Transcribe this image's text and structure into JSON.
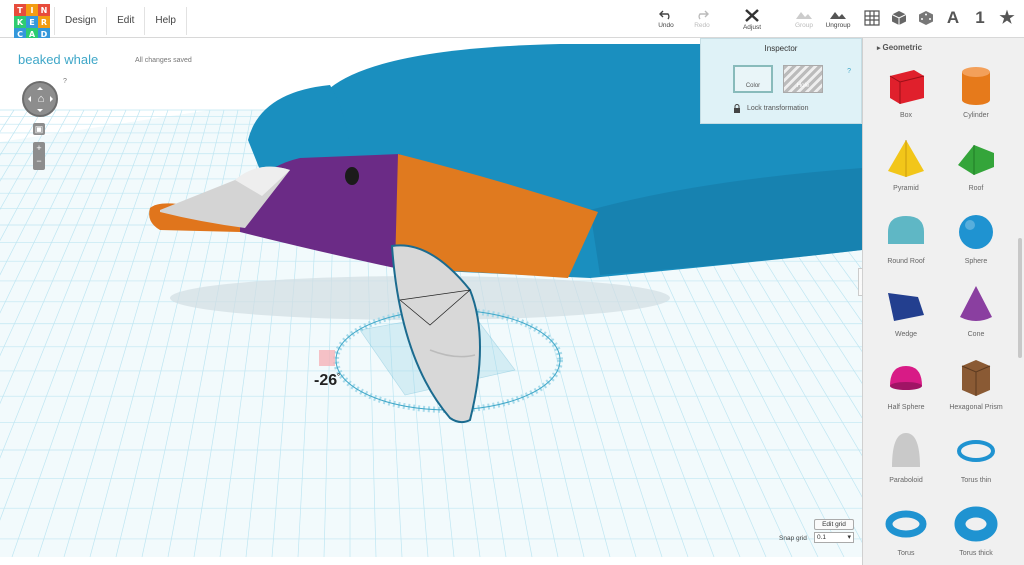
{
  "logo": {
    "letters": [
      "T",
      "I",
      "N",
      "K",
      "E",
      "R",
      "C",
      "A",
      "D"
    ],
    "colors": [
      "#e74c3c",
      "#f39c12",
      "#e74c3c",
      "#2ecc71",
      "#3498db",
      "#f39c12",
      "#3498db",
      "#2ecc71",
      "#3498db"
    ]
  },
  "menu": {
    "design": "Design",
    "edit": "Edit",
    "help": "Help"
  },
  "toolbar": {
    "undo": "Undo",
    "redo": "Redo",
    "adjust": "Adjust",
    "group": "Group",
    "ungroup": "Ungroup"
  },
  "view_tools": {
    "text_tool": "A",
    "number_tool": "1",
    "star_tool": "★"
  },
  "document": {
    "title": "beaked whale",
    "status": "All changes saved",
    "help_mark": "?"
  },
  "rotation": {
    "angle": "-26",
    "unit": "°"
  },
  "inspector": {
    "title": "Inspector",
    "color_label": "Color",
    "hole_label": "Hole",
    "lock_label": "Lock transformation",
    "help_mark": "?"
  },
  "library": {
    "section": "Geometric",
    "shapes": [
      {
        "label": "Box",
        "icon": "box-icon",
        "color": "#e0202c"
      },
      {
        "label": "Cylinder",
        "icon": "cylinder-icon",
        "color": "#e67a1b"
      },
      {
        "label": "Pyramid",
        "icon": "pyramid-icon",
        "color": "#f2c619"
      },
      {
        "label": "Roof",
        "icon": "roof-icon",
        "color": "#34a53a"
      },
      {
        "label": "Round Roof",
        "icon": "round-roof-icon",
        "color": "#5fb7c5"
      },
      {
        "label": "Sphere",
        "icon": "sphere-icon",
        "color": "#1f93d1"
      },
      {
        "label": "Wedge",
        "icon": "wedge-icon",
        "color": "#233f8f"
      },
      {
        "label": "Cone",
        "icon": "cone-icon",
        "color": "#8a3fa0"
      },
      {
        "label": "Half Sphere",
        "icon": "half-sphere-icon",
        "color": "#d81b86"
      },
      {
        "label": "Hexagonal Prism",
        "icon": "hexagonal-prism-icon",
        "color": "#8a5a34"
      },
      {
        "label": "Paraboloid",
        "icon": "paraboloid-icon",
        "color": "#c9c9c9"
      },
      {
        "label": "Torus thin",
        "icon": "torus-thin-icon",
        "color": "#1f93d1"
      },
      {
        "label": "Torus",
        "icon": "torus-icon",
        "color": "#1f93d1"
      },
      {
        "label": "Torus thick",
        "icon": "torus-thick-icon",
        "color": "#1f93d1"
      }
    ]
  },
  "grid": {
    "edit_label": "Edit grid",
    "snap_label": "Snap grid",
    "snap_value": "0.1"
  },
  "colors": {
    "whale_body": "#1a8fbf",
    "whale_head": "#6b2b86",
    "whale_band": "#e07a1f",
    "beak": "#dcdcdc",
    "grid": "#bfe6f2",
    "accent": "#3fa7c8"
  }
}
